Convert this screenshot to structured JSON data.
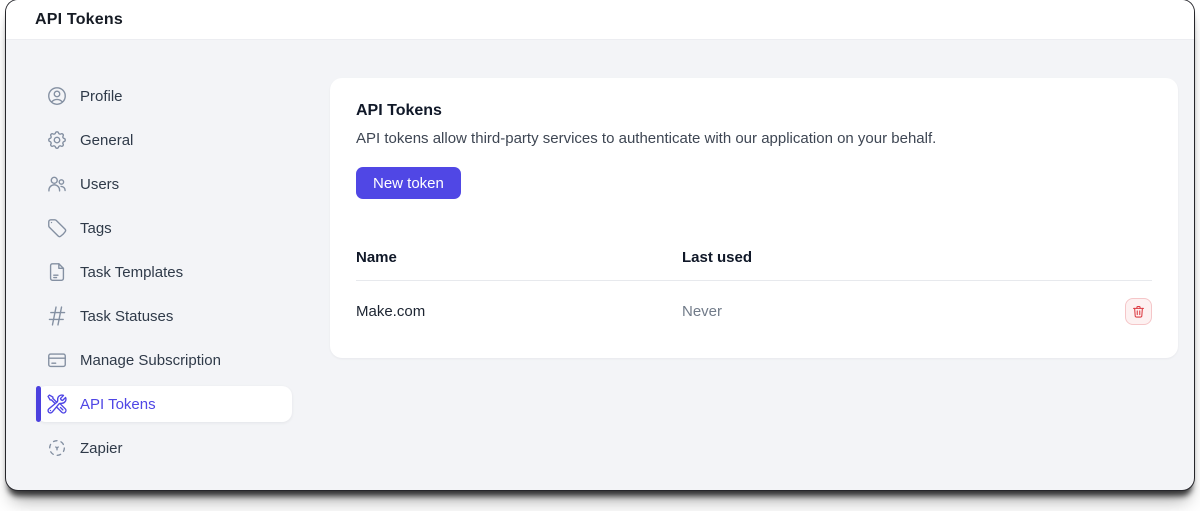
{
  "header": {
    "title": "API Tokens"
  },
  "sidebar": {
    "items": [
      {
        "label": "Profile",
        "icon": "user-circle-icon"
      },
      {
        "label": "General",
        "icon": "gear-icon"
      },
      {
        "label": "Users",
        "icon": "users-icon"
      },
      {
        "label": "Tags",
        "icon": "tag-icon"
      },
      {
        "label": "Task Templates",
        "icon": "document-icon"
      },
      {
        "label": "Task Statuses",
        "icon": "hash-icon"
      },
      {
        "label": "Manage Subscription",
        "icon": "credit-card-icon"
      },
      {
        "label": "API Tokens",
        "icon": "wrench-screwdriver-icon",
        "active": true
      },
      {
        "label": "Zapier",
        "icon": "zapier-icon"
      }
    ]
  },
  "card": {
    "title": "API Tokens",
    "description": "API tokens allow third-party services to authenticate with our application on your behalf.",
    "new_token_label": "New token"
  },
  "table": {
    "headers": [
      "Name",
      "Last used"
    ],
    "rows": [
      {
        "name": "Make.com",
        "last_used": "Never",
        "action_icon": "trash-icon"
      }
    ]
  },
  "colors": {
    "accent": "#4f46e5",
    "background": "#f3f4f7",
    "danger": "#dc3a41",
    "danger_bg": "#fdf1f1",
    "danger_border": "#f5c6c8"
  }
}
